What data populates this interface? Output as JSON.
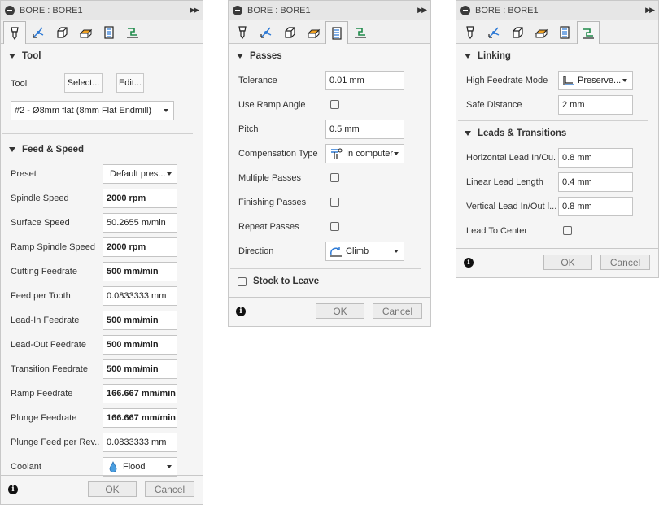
{
  "panels": {
    "tool": {
      "title": "BORE : BORE1",
      "sections": {
        "tool": {
          "header": "Tool",
          "tool_label": "Tool",
          "select_label": "Select...",
          "edit_label": "Edit...",
          "tool_value": "#2 - Ø8mm flat (8mm Flat Endmill)"
        },
        "feed": {
          "header": "Feed & Speed",
          "rows": [
            {
              "label": "Preset",
              "value": "Default pres..."
            },
            {
              "label": "Spindle Speed",
              "value": "2000 rpm"
            },
            {
              "label": "Surface Speed",
              "value": "50.2655 m/min"
            },
            {
              "label": "Ramp Spindle Speed",
              "value": "2000 rpm"
            },
            {
              "label": "Cutting Feedrate",
              "value": "500 mm/min"
            },
            {
              "label": "Feed per Tooth",
              "value": "0.0833333 mm"
            },
            {
              "label": "Lead-In Feedrate",
              "value": "500 mm/min"
            },
            {
              "label": "Lead-Out Feedrate",
              "value": "500 mm/min"
            },
            {
              "label": "Transition Feedrate",
              "value": "500 mm/min"
            },
            {
              "label": "Ramp Feedrate",
              "value": "166.667 mm/min"
            },
            {
              "label": "Plunge Feedrate",
              "value": "166.667 mm/min"
            },
            {
              "label": "Plunge Feed per Rev...",
              "value": "0.0833333 mm"
            },
            {
              "label": "Coolant",
              "value": "Flood"
            }
          ]
        }
      },
      "ok_label": "OK",
      "cancel_label": "Cancel"
    },
    "passes": {
      "title": "BORE : BORE1",
      "header": "Passes",
      "rows": [
        {
          "label": "Tolerance",
          "value": "0.01 mm"
        },
        {
          "label": "Use Ramp Angle",
          "checked": false
        },
        {
          "label": "Pitch",
          "value": "0.5 mm"
        },
        {
          "label": "Compensation Type",
          "value": "In computer"
        },
        {
          "label": "Multiple Passes",
          "checked": false
        },
        {
          "label": "Finishing Passes",
          "checked": false
        },
        {
          "label": "Repeat Passes",
          "checked": false
        },
        {
          "label": "Direction",
          "value": "Climb"
        }
      ],
      "stock_label": "Stock to Leave",
      "ok_label": "OK",
      "cancel_label": "Cancel"
    },
    "linking": {
      "title": "BORE : BORE1",
      "header": "Linking",
      "high_feedrate_label": "High Feedrate Mode",
      "high_feedrate_value": "Preserve...",
      "safe_distance_label": "Safe Distance",
      "safe_distance_value": "2 mm",
      "leads_header": "Leads & Transitions",
      "leads_rows": [
        {
          "label": "Horizontal Lead In/Ou...",
          "value": "0.8 mm"
        },
        {
          "label": "Linear Lead Length",
          "value": "0.4 mm"
        },
        {
          "label": "Vertical Lead In/Out l...",
          "value": "0.8 mm"
        }
      ],
      "lead_to_center_label": "Lead To Center",
      "ok_label": "OK",
      "cancel_label": "Cancel"
    }
  },
  "tabs": [
    "tool-tab-icon",
    "geometry-tab-icon",
    "heights-tab-icon",
    "passes-tab-icon",
    "linking-tab-icon",
    "leads-tab-icon"
  ],
  "colors": {
    "panel_bg": "#f5f5f5",
    "title_bg": "#e6e6e6",
    "accent_blue": "#2f7bd6",
    "accent_orange": "#f0a020",
    "accent_green": "#1f8a4a"
  }
}
